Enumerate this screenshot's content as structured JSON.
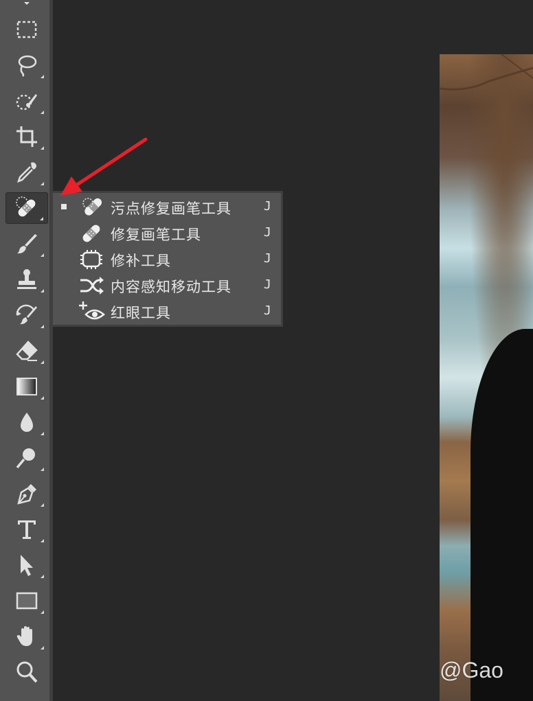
{
  "toolbar": {
    "tools": [
      {
        "name": "move-tool",
        "icon": "move-icon"
      },
      {
        "name": "rectangular-marquee-tool",
        "icon": "marquee-icon"
      },
      {
        "name": "lasso-tool",
        "icon": "lasso-icon"
      },
      {
        "name": "quick-selection-tool",
        "icon": "quick-selection-icon"
      },
      {
        "name": "crop-tool",
        "icon": "crop-icon"
      },
      {
        "name": "eyedropper-tool",
        "icon": "eyedropper-icon"
      },
      {
        "name": "spot-healing-brush-tool",
        "icon": "bandage-icon",
        "active": true
      },
      {
        "name": "brush-tool",
        "icon": "brush-icon"
      },
      {
        "name": "clone-stamp-tool",
        "icon": "stamp-icon"
      },
      {
        "name": "history-brush-tool",
        "icon": "history-brush-icon"
      },
      {
        "name": "eraser-tool",
        "icon": "eraser-icon"
      },
      {
        "name": "gradient-tool",
        "icon": "gradient-icon"
      },
      {
        "name": "blur-tool",
        "icon": "drop-icon"
      },
      {
        "name": "dodge-tool",
        "icon": "dodge-icon"
      },
      {
        "name": "pen-tool",
        "icon": "pen-icon"
      },
      {
        "name": "type-tool",
        "icon": "type-icon"
      },
      {
        "name": "path-selection-tool",
        "icon": "arrow-cursor-icon"
      },
      {
        "name": "rectangle-tool",
        "icon": "rectangle-icon"
      },
      {
        "name": "hand-tool",
        "icon": "hand-icon"
      },
      {
        "name": "zoom-tool",
        "icon": "magnifier-icon"
      }
    ]
  },
  "flyout": {
    "items": [
      {
        "label": "污点修复画笔工具",
        "shortcut": "J",
        "icon": "spot-healing-icon",
        "selected": true
      },
      {
        "label": "修复画笔工具",
        "shortcut": "J",
        "icon": "healing-brush-icon",
        "selected": false
      },
      {
        "label": "修补工具",
        "shortcut": "J",
        "icon": "patch-icon",
        "selected": false
      },
      {
        "label": "内容感知移动工具",
        "shortcut": "J",
        "icon": "content-aware-move-icon",
        "selected": false
      },
      {
        "label": "红眼工具",
        "shortcut": "J",
        "icon": "red-eye-icon",
        "selected": false
      }
    ]
  },
  "canvas": {
    "watermark": "@Gao"
  },
  "colors": {
    "annotation_arrow": "#e8212b",
    "toolbar_bg": "#535353",
    "workspace_bg": "#282828"
  }
}
